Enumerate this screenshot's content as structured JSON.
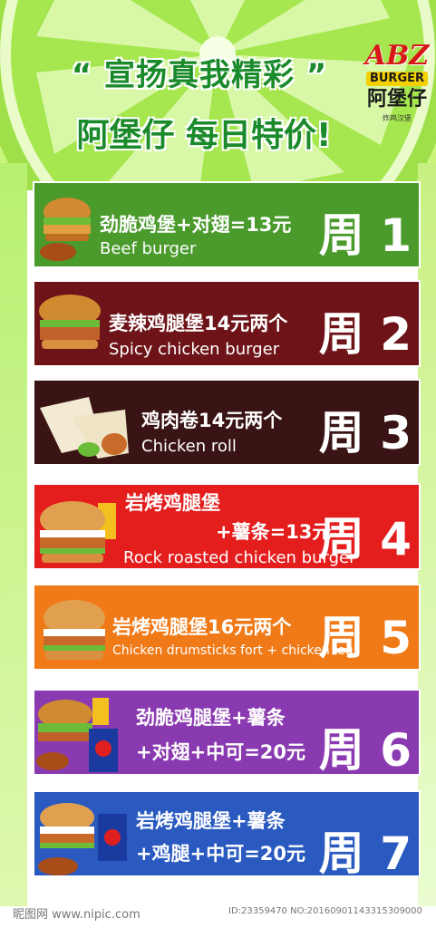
{
  "header": {
    "slogan_line1": "“ 宣扬真我精彩 ”",
    "slogan_line2": "阿堡仔 每日特价!",
    "logo_abz": "ABZ",
    "logo_burger": "BURGER",
    "logo_cn": "阿堡仔",
    "logo_sub": "炸鸡汉堡"
  },
  "items": [
    {
      "cn": "劲脆鸡堡+对翅=13元",
      "en": "Beef burger",
      "day": "周 1",
      "color": "#4a9a2c"
    },
    {
      "cn": "麦辣鸡腿堡14元两个",
      "en": "Spicy chicken burger",
      "day": "周 2",
      "color": "#6e1418"
    },
    {
      "cn": "鸡肉卷14元两个",
      "en": "Chicken roll",
      "day": "周 3",
      "color": "#3a1414"
    },
    {
      "cn1": "岩烤鸡腿堡",
      "cn2": "+薯条=13元",
      "en": "Rock roasted chicken burger",
      "day": "周 4",
      "color": "#e41d1d"
    },
    {
      "cn": "岩烤鸡腿堡16元两个",
      "en": "Chicken drumsticks fort + chicken leg",
      "day": "周 5",
      "color": "#f07a18"
    },
    {
      "cn1": "劲脆鸡腿堡+薯条",
      "cn2": "+对翅+中可=20元",
      "day": "周 6",
      "color": "#8a3ab0"
    },
    {
      "cn1": "岩烤鸡腿堡+薯条",
      "cn2": "+鸡腿+中可=20元",
      "day": "周 7",
      "color": "#2a5ac0"
    }
  ],
  "footer": {
    "left": "昵图网 www.nipic.com",
    "right": "ID:23359470 NO:20160901143315309000"
  }
}
